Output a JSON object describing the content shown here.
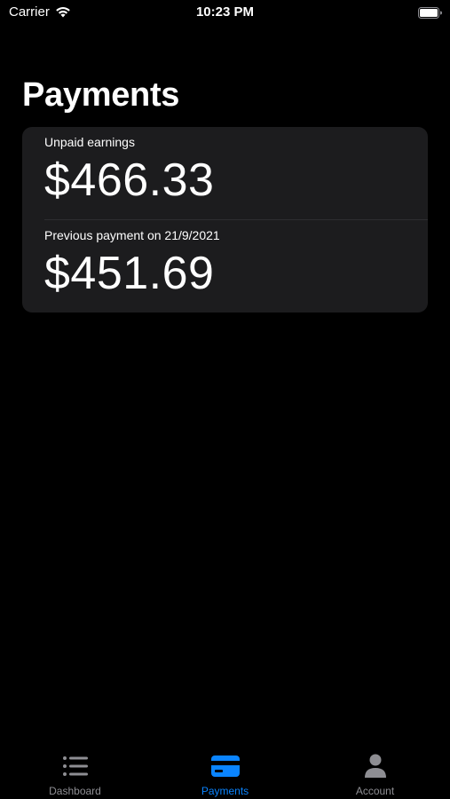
{
  "status_bar": {
    "carrier": "Carrier",
    "time": "10:23 PM"
  },
  "page": {
    "title": "Payments"
  },
  "card": {
    "unpaid": {
      "label": "Unpaid earnings",
      "amount": "$466.33"
    },
    "previous": {
      "label": "Previous payment on 21/9/2021",
      "amount": "$451.69"
    }
  },
  "tabs": [
    {
      "label": "Dashboard",
      "icon": "list-icon",
      "active": false
    },
    {
      "label": "Payments",
      "icon": "credit-card-icon",
      "active": true
    },
    {
      "label": "Account",
      "icon": "person-icon",
      "active": false
    }
  ],
  "colors": {
    "background": "#000000",
    "card": "#1c1c1e",
    "accent": "#0a84ff",
    "inactive": "#8e8e93"
  }
}
